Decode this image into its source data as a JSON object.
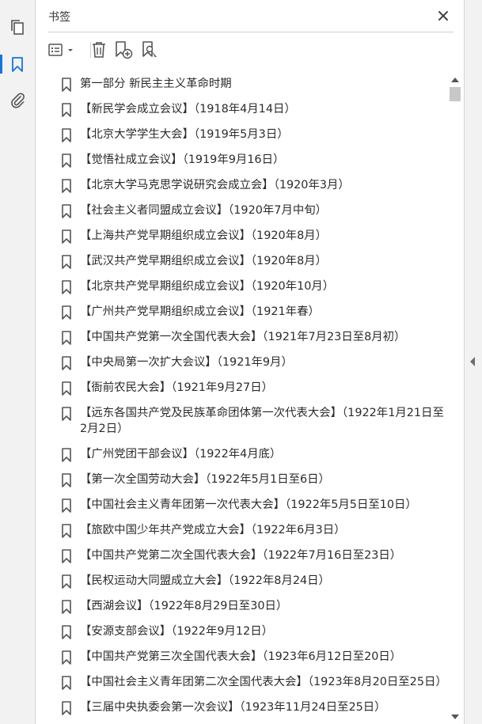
{
  "panel": {
    "title": "书签"
  },
  "icons": {
    "side": [
      "pages-icon",
      "bookmark-icon",
      "attachment-icon"
    ],
    "toolbar": [
      "options-menu-icon",
      "delete-icon",
      "new-bookmark-icon",
      "bookmark-search-icon"
    ]
  },
  "colors": {
    "accent": "#1473e6",
    "icon": "#555555",
    "text": "#2b2b2b"
  },
  "bookmarks": [
    "第一部分  新民主主义革命时期",
    "【新民学会成立会议】（1918年4月14日）",
    "【北京大学学生大会】（1919年5月3日）",
    "【觉悟社成立会议】（1919年9月16日）",
    "【北京大学马克思学说研究会成立会】（1920年3月）",
    "【社会主义者同盟成立会议】（1920年7月中旬）",
    "【上海共产党早期组织成立会议】（1920年8月）",
    "【武汉共产党早期组织成立会议】（1920年8月）",
    "【北京共产党早期组织成立会议】（1920年10月）",
    "【广州共产党早期组织成立会议】（1921年春）",
    "【中国共产党第一次全国代表大会】（1921年7月23日至8月初）",
    "【中央局第一次扩大会议】（1921年9月）",
    "【衙前农民大会】（1921年9月27日）",
    "【远东各国共产党及民族革命团体第一次代表大会】（1922年1月21日至2月2日）",
    "【广州党团干部会议】（1922年4月底）",
    "【第一次全国劳动大会】（1922年5月1日至6日）",
    "【中国社会主义青年团第一次代表大会】（1922年5月5日至10日）",
    "【旅欧中国少年共产党成立大会】（1922年6月3日）",
    "【中国共产党第二次全国代表大会】（1922年7月16日至23日）",
    "【民权运动大同盟成立大会】（1922年8月24日）",
    "【西湖会议】（1922年8月29日至30日）",
    "【安源支部会议】（1922年9月12日）",
    "【中国共产党第三次全国代表大会】（1923年6月12日至20日）",
    "【中国社会主义青年团第二次全国代表大会】（1923年8月20日至25日）",
    "【三届中央执委会第一次会议】（1923年11月24日至25日）"
  ]
}
